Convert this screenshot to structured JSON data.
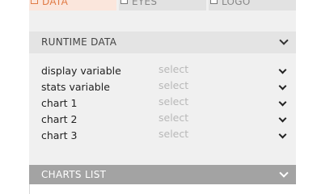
{
  "tabs": [
    {
      "label": "DATA"
    },
    {
      "label": "EYES"
    },
    {
      "label": "LOGO"
    }
  ],
  "runtime": {
    "title": "RUNTIME DATA",
    "rows": [
      {
        "label": "display variable",
        "value": "select"
      },
      {
        "label": "stats variable",
        "value": "select"
      },
      {
        "label": "chart 1",
        "value": "select"
      },
      {
        "label": "chart 2",
        "value": "select"
      },
      {
        "label": "chart 3",
        "value": "select"
      }
    ]
  },
  "charts_list": {
    "title": "CHARTS LIST"
  },
  "colors": {
    "accent": "#e07a45",
    "active_tab_bg": "#fbe6dc",
    "panel_bg": "#f0f0f0",
    "charts_header_bg": "#a3a3a3"
  }
}
